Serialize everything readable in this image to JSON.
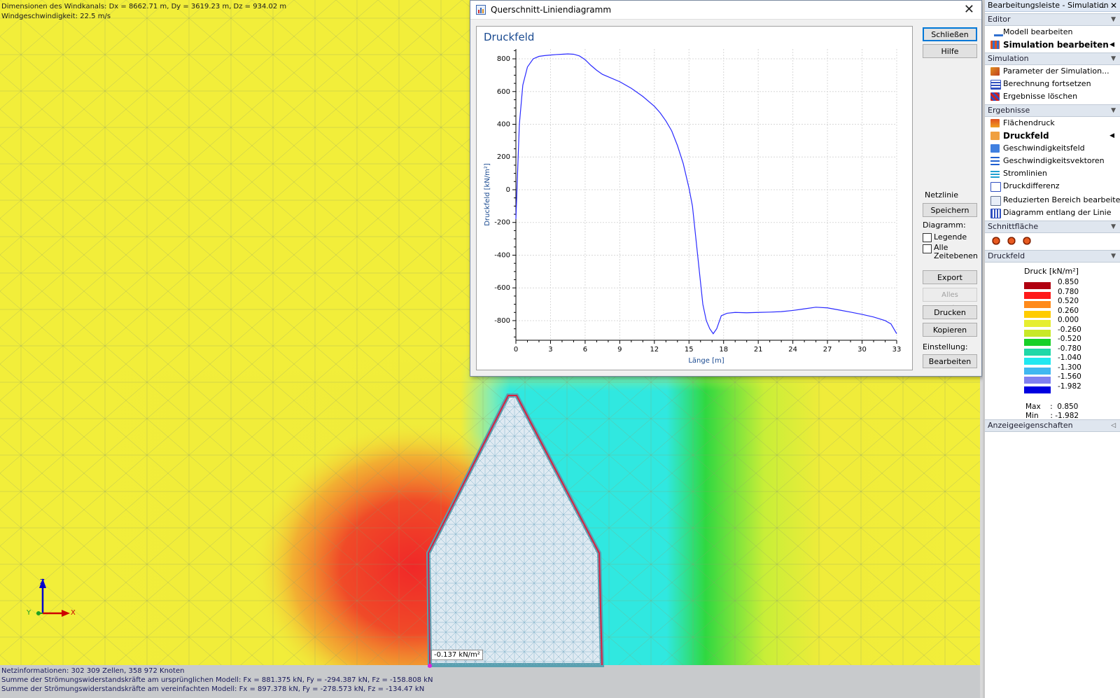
{
  "viewport": {
    "info_top": [
      "Dimensionen des Windkanals: Dx = 8662.71 m, Dy = 3619.23 m, Dz = 934.02 m",
      "Windgeschwindigkeit: 22.5 m/s"
    ],
    "info_bottom": [
      "Netzinformationen: 302 309 Zellen, 358 972 Knoten",
      "Summe der Strömungswiderstandskräfte am ursprünglichen Modell: Fx = 881.375 kN, Fy = -294.387 kN, Fz = -158.808 kN",
      "Summe der Strömungswiderstandskräfte am vereinfachten Modell: Fx = 897.378 kN, Fy = -278.573 kN, Fz = -134.47 kN"
    ],
    "probe_label": "-0.137 kN/m²",
    "axis_labels": {
      "z": "Z",
      "x": "X",
      "y": "Y"
    }
  },
  "dialog": {
    "title": "Querschnitt-Liniendiagramm",
    "buttons": {
      "close": "Schließen",
      "help": "Hilfe",
      "save": "Speichern",
      "export": "Export",
      "export_all": "Alles exportieren",
      "print": "Drucken",
      "copy": "Kopieren",
      "edit": "Bearbeiten"
    },
    "labels": {
      "mesh_line": "Netzlinie",
      "diagram": "Diagramm:",
      "setting": "Einstellung:"
    },
    "checkboxes": {
      "legend": "Legende",
      "all_time": "Alle Zeitebenen"
    }
  },
  "chart_data": {
    "type": "line",
    "title": "Druckfeld",
    "xlabel": "Länge [m]",
    "ylabel": "Druckfeld [kN/m²]",
    "xlim": [
      0,
      33
    ],
    "ylim": [
      -920,
      860
    ],
    "x_ticks": [
      0,
      3,
      6,
      9,
      12,
      15,
      18,
      21,
      24,
      27,
      30,
      33
    ],
    "y_ticks": [
      800,
      600,
      400,
      200,
      0,
      -200,
      -400,
      -600,
      -800
    ],
    "grid": true,
    "series": [
      {
        "name": "",
        "color": "#2a2aff",
        "x": [
          0,
          0.3,
          0.6,
          1.0,
          1.5,
          2.0,
          2.5,
          3.0,
          3.5,
          4.0,
          4.5,
          5.0,
          5.5,
          6.0,
          6.5,
          7.0,
          7.5,
          8.0,
          9.0,
          10.0,
          11.0,
          12.0,
          12.5,
          13.0,
          13.5,
          14.0,
          14.5,
          15.0,
          15.3,
          15.6,
          15.9,
          16.2,
          16.5,
          16.8,
          17.1,
          17.4,
          17.8,
          18.3,
          19.0,
          20.0,
          21.0,
          22.0,
          23.0,
          24.0,
          25.0,
          26.0,
          27.0,
          28.0,
          29.0,
          30.0,
          31.0,
          32.0,
          32.5,
          33.0
        ],
        "y": [
          -180,
          400,
          640,
          750,
          800,
          815,
          820,
          823,
          826,
          828,
          830,
          828,
          818,
          795,
          760,
          730,
          705,
          690,
          660,
          620,
          570,
          510,
          470,
          420,
          360,
          270,
          160,
          10,
          -100,
          -300,
          -500,
          -700,
          -800,
          -850,
          -880,
          -850,
          -770,
          -755,
          -750,
          -752,
          -750,
          -748,
          -745,
          -738,
          -728,
          -718,
          -722,
          -735,
          -748,
          -762,
          -778,
          -800,
          -820,
          -880
        ]
      }
    ]
  },
  "sidebar": {
    "title": "Bearbeitungsleiste - Simulation",
    "sections": {
      "editor": "Editor",
      "simulation": "Simulation",
      "results": "Ergebnisse",
      "cut_plane": "Schnittfläche",
      "pressure_field": "Druckfeld",
      "display_props": "Anzeigeeigenschaften"
    },
    "editor_items": [
      "Modell bearbeiten",
      "Simulation bearbeiten"
    ],
    "simulation_items": [
      "Parameter der Simulation...",
      "Berechnung fortsetzen",
      "Ergebnisse löschen"
    ],
    "results_items": [
      "Flächendruck",
      "Druckfeld",
      "Geschwindigkeitsfeld",
      "Geschwindigkeitsvektoren",
      "Stromlinien",
      "Druckdifferenz",
      "Reduzierten Bereich bearbeiten",
      "Diagramm entlang der Linie"
    ],
    "legend": {
      "title": "Druck [kN/m²]",
      "values": [
        "0.850",
        "0.780",
        "0.520",
        "0.260",
        "0.000",
        "-0.260",
        "-0.520",
        "-0.780",
        "-1.040",
        "-1.300",
        "-1.560",
        "-1.982"
      ],
      "colors": [
        "#b00010",
        "#ff1a1a",
        "#ff8a1a",
        "#ffcc00",
        "#e6ee30",
        "#c8e828",
        "#18d028",
        "#20d8a8",
        "#20e8f0",
        "#40b8f0",
        "#8080f0",
        "#0000e0"
      ],
      "max_label": "Max",
      "min_label": "Min",
      "max_value": "0.850",
      "min_value": "-1.982"
    }
  }
}
